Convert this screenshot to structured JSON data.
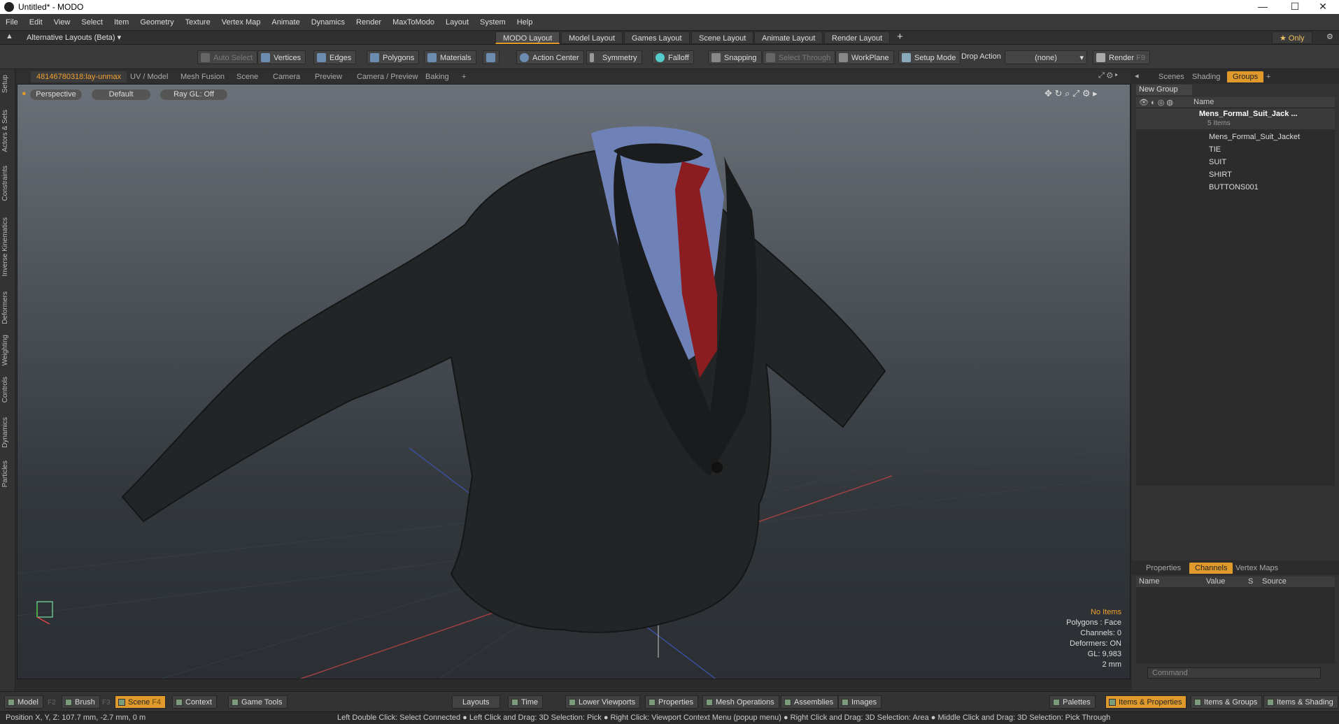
{
  "window": {
    "title": "Untitled* - MODO",
    "minimize": "—",
    "maximize": "☐",
    "close": "✕"
  },
  "menu": [
    "File",
    "Edit",
    "View",
    "Select",
    "Item",
    "Geometry",
    "Texture",
    "Vertex Map",
    "Animate",
    "Dynamics",
    "Render",
    "MaxToModo",
    "Layout",
    "System",
    "Help"
  ],
  "layouts": {
    "switcher": "Alternative Layouts (Beta) ▾",
    "tabs": [
      "MODO Layout",
      "Model Layout",
      "Games Layout",
      "Scene Layout",
      "Animate Layout",
      "Render Layout"
    ],
    "active": "MODO Layout",
    "add": "+",
    "only": "★ Only"
  },
  "toolbar": {
    "auto_select": "Auto Select",
    "vertices": "Vertices",
    "edges": "Edges",
    "polygons": "Polygons",
    "materials": "Materials",
    "action_center": "Action Center",
    "symmetry": "Symmetry",
    "falloff": "Falloff",
    "snapping": "Snapping",
    "select_through": "Select Through",
    "workplane": "WorkPlane",
    "setup_mode": "Setup Mode",
    "drop_action": "Drop Action",
    "drop_value": "(none)",
    "render": "Render",
    "render_key": "F9"
  },
  "left_tabs": [
    "Setup",
    "Actors & Sets",
    "Constraints",
    "Inverse Kinematics",
    "Deformers",
    "Weighting",
    "Controls",
    "Dynamics",
    "Particles"
  ],
  "viewport_tabs": [
    "48146780318:lay-unmax",
    "UV / Model",
    "Mesh Fusion",
    "Scene",
    "Camera",
    "Preview",
    "Camera / Preview",
    "Baking"
  ],
  "viewport_tab_add": "+",
  "viewport": {
    "view": "Perspective",
    "shading": "Default",
    "raygl": "Ray GL: Off",
    "info": {
      "items": "No Items",
      "polygons": "Polygons : Face",
      "channels": "Channels: 0",
      "deformers": "Deformers: ON",
      "gl": "GL: 9,983",
      "grid": "2 mm"
    }
  },
  "right_top_tabs": [
    "Scenes",
    "Shading",
    "Groups"
  ],
  "right_top_active": "Groups",
  "groups": {
    "new_group": "New Group",
    "col_name": "Name",
    "root": "Mens_Formal_Suit_Jack ...",
    "root_count": "5 Items",
    "children": [
      "Mens_Formal_Suit_Jacket",
      "TIE",
      "SUIT",
      "SHIRT",
      "BUTTONS001"
    ]
  },
  "right_bottom_tabs": [
    "Properties",
    "Channels",
    "Vertex Maps"
  ],
  "right_bottom_active": "Channels",
  "channels": {
    "cols": [
      "Name",
      "Value",
      "S",
      "Source"
    ]
  },
  "command_placeholder": "Command",
  "bottom": {
    "left": [
      {
        "label": "Model",
        "key": "F2"
      },
      {
        "label": "Brush",
        "key": "F3"
      },
      {
        "label": "Scene",
        "key": "F4"
      },
      {
        "label": "Context",
        "key": ""
      },
      {
        "label": "Game Tools",
        "key": ""
      }
    ],
    "active": "Scene",
    "center": [
      "Layouts",
      "Time",
      "Lower Viewports",
      "Properties",
      "Mesh Operations",
      "Assemblies",
      "Images"
    ],
    "right": [
      "Palettes",
      "Items & Properties",
      "Items & Groups",
      "Items & Shading"
    ],
    "right_active": "Items & Properties"
  },
  "status": {
    "position": "Position X, Y, Z:   107.7 mm, -2.7 mm, 0 m",
    "hint": "Left Double Click: Select Connected ● Left Click and Drag: 3D Selection: Pick ● Right Click: Viewport Context Menu (popup menu) ● Right Click and Drag: 3D Selection: Area ● Middle Click and Drag: 3D Selection: Pick Through"
  }
}
